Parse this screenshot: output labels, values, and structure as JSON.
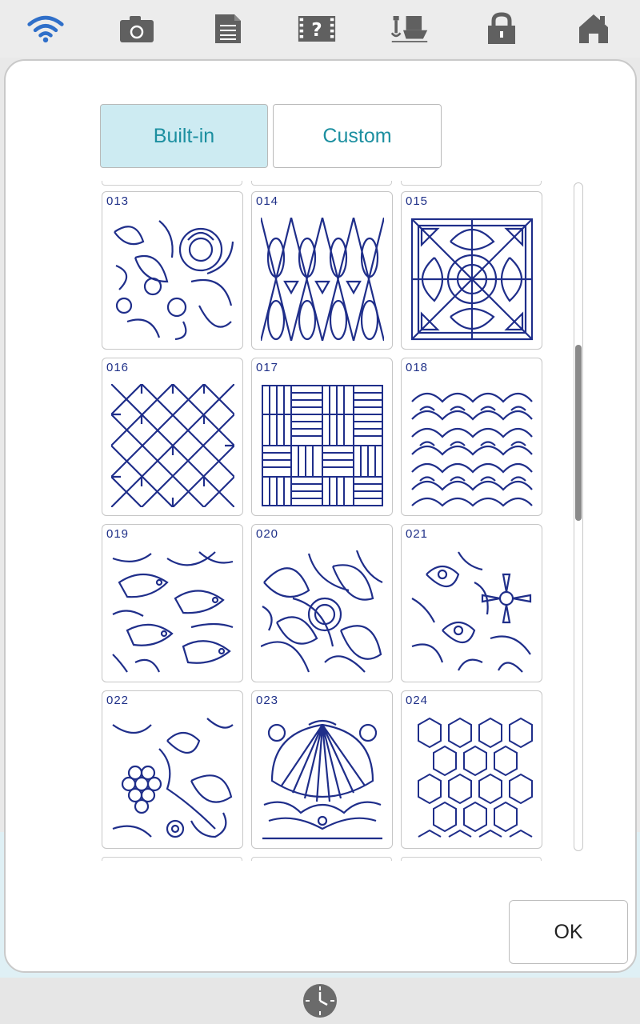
{
  "tabs": {
    "builtin": "Built-in",
    "custom": "Custom"
  },
  "tiles": [
    {
      "number": "013",
      "pattern": "rose-floral"
    },
    {
      "number": "014",
      "pattern": "diamond-lattice"
    },
    {
      "number": "015",
      "pattern": "celtic-medallion"
    },
    {
      "number": "016",
      "pattern": "star-crosshatch"
    },
    {
      "number": "017",
      "pattern": "basketweave"
    },
    {
      "number": "018",
      "pattern": "scallop-shells"
    },
    {
      "number": "019",
      "pattern": "birds-foliage"
    },
    {
      "number": "020",
      "pattern": "art-nouveau"
    },
    {
      "number": "021",
      "pattern": "blossom"
    },
    {
      "number": "022",
      "pattern": "grapes-vine"
    },
    {
      "number": "023",
      "pattern": "shell-fan"
    },
    {
      "number": "024",
      "pattern": "hexagon-grid"
    }
  ],
  "ok_label": "OK",
  "toolbar_icons": [
    "wifi-icon",
    "camera-icon",
    "document-icon",
    "help-icon",
    "presser-foot-icon",
    "lock-icon",
    "home-icon"
  ],
  "colors": {
    "accent": "#1c8fa0",
    "pattern": "#1f2e8a",
    "selected_tab": "#cdebf2"
  },
  "scroll": {
    "position": 0.36
  }
}
